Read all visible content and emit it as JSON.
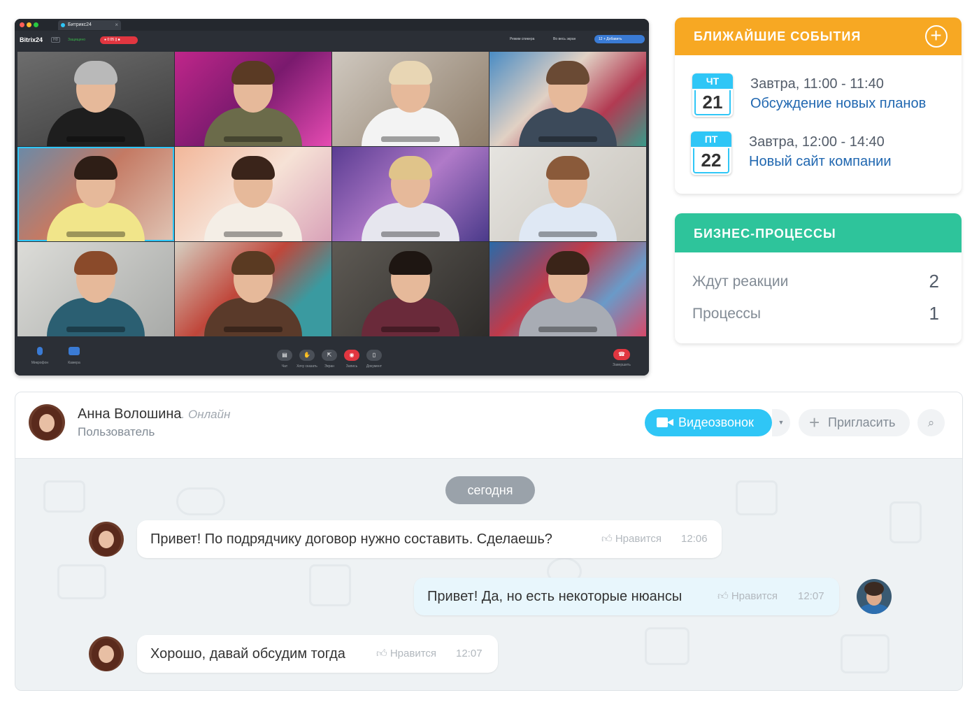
{
  "video_call": {
    "tab_title": "Битрикс24",
    "tab_close": "×",
    "logo": "Bitrix24",
    "hd_badge": "HD",
    "secure_label": "Защищено",
    "rec_timer": "● 0:05  ||  ■",
    "header_buttons": [
      "Режим спикера",
      "Во весь экран"
    ],
    "users_button": "12   + Добавить",
    "controls": {
      "mic_label": "Микрофон",
      "camera_label": "Камера",
      "chat_label": "Чат",
      "hand_label": "Хочу сказать",
      "screen_label": "Экран",
      "record_label": "Запись",
      "document_label": "Документ",
      "end_label": "Завершить"
    },
    "participant_count": 12
  },
  "events_card": {
    "title": "БЛИЖАЙШИЕ СОБЫТИЯ",
    "add_icon": "plus-circle-icon",
    "events": [
      {
        "weekday": "ЧТ",
        "day": "21",
        "time": "Завтра, 11:00 - 11:40",
        "title": "Обсуждение новых планов"
      },
      {
        "weekday": "ПТ",
        "day": "22",
        "time": "Завтра, 12:00 - 14:40",
        "title": "Новый сайт компании"
      }
    ]
  },
  "bp_card": {
    "title": "БИЗНЕС-ПРОЦЕССЫ",
    "rows": [
      {
        "label": "Ждут реакции",
        "value": "2"
      },
      {
        "label": "Процессы",
        "value": "1"
      }
    ]
  },
  "chat": {
    "user_name": "Анна Волошина",
    "user_status": ". Онлайн",
    "user_role": "Пользователь",
    "video_button": "Видеозвонок",
    "invite_button": "Пригласить",
    "date_separator": "сегодня",
    "messages": [
      {
        "text": "Привет! По подрядчику договор нужно составить. Сделаешь?",
        "like": "Нравится",
        "time": "12:06",
        "mine": false
      },
      {
        "text": "Привет! Да, но есть некоторые нюансы",
        "like": "Нравится",
        "time": "12:07",
        "mine": true
      },
      {
        "text": "Хорошо, давай обсудим тогда",
        "like": "Нравится",
        "time": "12:07",
        "mine": false
      }
    ]
  },
  "colors": {
    "events_accent": "#f7a823",
    "bp_accent": "#2ec49b",
    "primary_blue": "#2fc6f6",
    "link_blue": "#2067b0"
  }
}
